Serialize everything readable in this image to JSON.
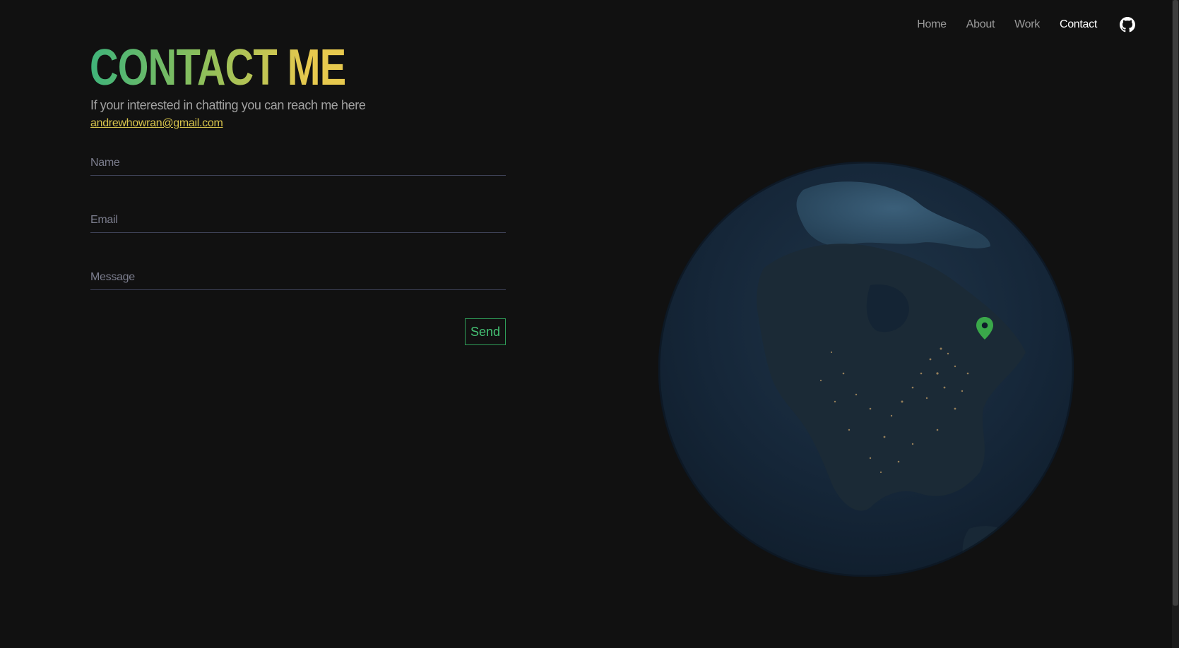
{
  "nav": {
    "items": [
      {
        "label": "Home"
      },
      {
        "label": "About"
      },
      {
        "label": "Work"
      },
      {
        "label": "Contact"
      }
    ],
    "active": "Contact",
    "github_icon": "github-icon"
  },
  "hero": {
    "title": "CONTACT ME",
    "subtitle": "If your interested in chatting you can reach me here",
    "email": "andrewhowran@gmail.com"
  },
  "form": {
    "name_placeholder": "Name",
    "email_placeholder": "Email",
    "message_placeholder": "Message",
    "send_label": "Send"
  },
  "globe": {
    "marker_icon": "location-pin-icon"
  },
  "colors": {
    "background": "#111111",
    "accent_green": "#45c274",
    "accent_yellow": "#d9c54c",
    "marker_green": "#3aa84a"
  }
}
